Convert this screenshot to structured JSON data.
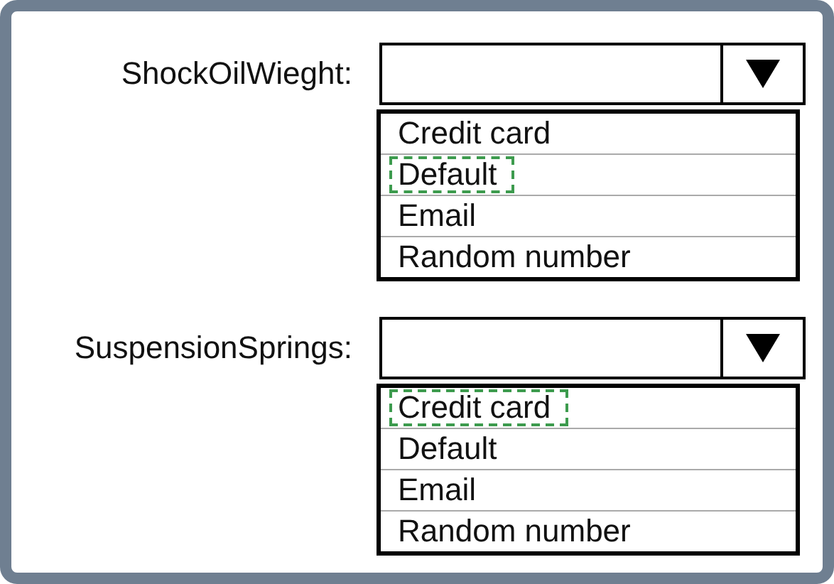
{
  "fields": [
    {
      "label": "ShockOilWieght:",
      "options": [
        {
          "text": "Credit card",
          "selected": false
        },
        {
          "text": "Default",
          "selected": true
        },
        {
          "text": "Email",
          "selected": false
        },
        {
          "text": "Random number",
          "selected": false
        }
      ]
    },
    {
      "label": "SuspensionSprings:",
      "options": [
        {
          "text": "Credit card",
          "selected": true
        },
        {
          "text": "Default",
          "selected": false
        },
        {
          "text": "Email",
          "selected": false
        },
        {
          "text": "Random number",
          "selected": false
        }
      ]
    }
  ]
}
